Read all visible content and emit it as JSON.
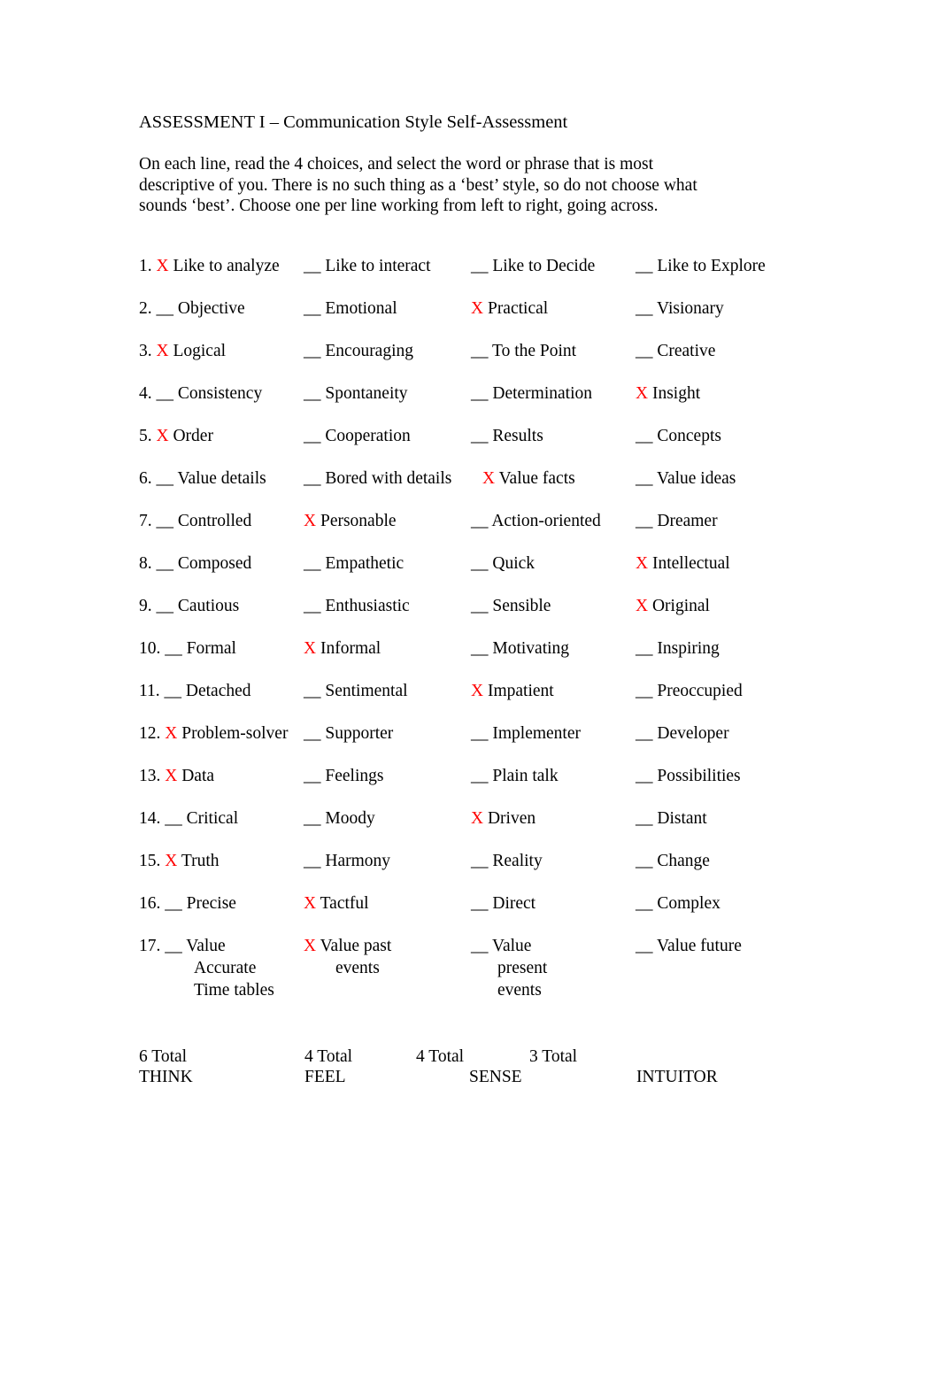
{
  "document": {
    "title": "ASSESSMENT I – Communication Style Self-Assessment",
    "intro_lines": [
      "On each line, read the 4 choices, and select the word or phrase that is most",
      "descriptive of you. There is no such thing as a ‘best’ style, so do not choose what",
      "sounds ‘best’. Choose one per line working from left to right, going across."
    ]
  },
  "marks": {
    "selected": "X",
    "unselected": "__",
    "selected_color": "#ff0000"
  },
  "rows": [
    {
      "number": "1.",
      "options": [
        {
          "mark": "X",
          "selected": true,
          "label": "Like to analyze"
        },
        {
          "mark": "__",
          "selected": false,
          "label": "Like to interact"
        },
        {
          "mark": "__",
          "selected": false,
          "label": "Like to Decide"
        },
        {
          "mark": "__",
          "selected": false,
          "label": "Like to Explore"
        }
      ]
    },
    {
      "number": "2.",
      "options": [
        {
          "mark": "__",
          "selected": false,
          "label": "Objective"
        },
        {
          "mark": "__",
          "selected": false,
          "label": "Emotional"
        },
        {
          "mark": "X",
          "selected": true,
          "label": "Practical"
        },
        {
          "mark": "__",
          "selected": false,
          "label": "Visionary"
        }
      ]
    },
    {
      "number": "3.",
      "options": [
        {
          "mark": "X",
          "selected": true,
          "label": "Logical"
        },
        {
          "mark": "__",
          "selected": false,
          "label": "Encouraging"
        },
        {
          "mark": "__",
          "selected": false,
          "label": "To the Point"
        },
        {
          "mark": "__",
          "selected": false,
          "label": "Creative"
        }
      ]
    },
    {
      "number": "4.",
      "options": [
        {
          "mark": "__",
          "selected": false,
          "label": "Consistency"
        },
        {
          "mark": "__",
          "selected": false,
          "label": "Spontaneity"
        },
        {
          "mark": "__",
          "selected": false,
          "label": "Determination"
        },
        {
          "mark": "X",
          "selected": true,
          "label": "Insight"
        }
      ]
    },
    {
      "number": "5.",
      "options": [
        {
          "mark": "X",
          "selected": true,
          "label": "Order"
        },
        {
          "mark": "__",
          "selected": false,
          "label": "Cooperation"
        },
        {
          "mark": "__",
          "selected": false,
          "label": "Results"
        },
        {
          "mark": "__",
          "selected": false,
          "label": "Concepts"
        }
      ]
    },
    {
      "number": "6.",
      "options": [
        {
          "mark": "__",
          "selected": false,
          "label": "Value details"
        },
        {
          "mark": "__",
          "selected": false,
          "label": "Bored with details"
        },
        {
          "mark": "X",
          "selected": true,
          "label": "Value facts"
        },
        {
          "mark": "__",
          "selected": false,
          "label": "Value ideas"
        }
      ]
    },
    {
      "number": "7.",
      "options": [
        {
          "mark": "__",
          "selected": false,
          "label": "Controlled"
        },
        {
          "mark": "X",
          "selected": true,
          "label": "Personable"
        },
        {
          "mark": "__",
          "selected": false,
          "label": "Action-oriented"
        },
        {
          "mark": "__",
          "selected": false,
          "label": "Dreamer"
        }
      ]
    },
    {
      "number": "8.",
      "options": [
        {
          "mark": "__",
          "selected": false,
          "label": "Composed"
        },
        {
          "mark": "__",
          "selected": false,
          "label": "Empathetic"
        },
        {
          "mark": "__",
          "selected": false,
          "label": "Quick"
        },
        {
          "mark": "X",
          "selected": true,
          "label": "Intellectual"
        }
      ]
    },
    {
      "number": "9.",
      "options": [
        {
          "mark": "__",
          "selected": false,
          "label": "Cautious"
        },
        {
          "mark": "__",
          "selected": false,
          "label": "Enthusiastic"
        },
        {
          "mark": "__",
          "selected": false,
          "label": "Sensible"
        },
        {
          "mark": "X",
          "selected": true,
          "label": "Original"
        }
      ]
    },
    {
      "number": "10.",
      "options": [
        {
          "mark": "__",
          "selected": false,
          "label": "Formal"
        },
        {
          "mark": "X",
          "selected": true,
          "label": "Informal"
        },
        {
          "mark": "__",
          "selected": false,
          "label": "Motivating"
        },
        {
          "mark": "__",
          "selected": false,
          "label": "Inspiring"
        }
      ]
    },
    {
      "number": "11.",
      "options": [
        {
          "mark": "__",
          "selected": false,
          "label": "Detached"
        },
        {
          "mark": "__",
          "selected": false,
          "label": "Sentimental"
        },
        {
          "mark": "X",
          "selected": true,
          "label": "Impatient"
        },
        {
          "mark": "__",
          "selected": false,
          "label": "Preoccupied"
        }
      ]
    },
    {
      "number": "12.",
      "options": [
        {
          "mark": "X",
          "selected": true,
          "label": "Problem-solver"
        },
        {
          "mark": "__",
          "selected": false,
          "label": "Supporter"
        },
        {
          "mark": "__",
          "selected": false,
          "label": "Implementer"
        },
        {
          "mark": "__",
          "selected": false,
          "label": "Developer"
        }
      ]
    },
    {
      "number": "13.",
      "options": [
        {
          "mark": "X",
          "selected": true,
          "label": "Data"
        },
        {
          "mark": "__",
          "selected": false,
          "label": "Feelings"
        },
        {
          "mark": "__",
          "selected": false,
          "label": "Plain talk"
        },
        {
          "mark": "__",
          "selected": false,
          "label": "Possibilities"
        }
      ]
    },
    {
      "number": "14.",
      "options": [
        {
          "mark": "__",
          "selected": false,
          "label": "Critical"
        },
        {
          "mark": "__",
          "selected": false,
          "label": "Moody"
        },
        {
          "mark": "X",
          "selected": true,
          "label": "Driven"
        },
        {
          "mark": "__",
          "selected": false,
          "label": "Distant"
        }
      ]
    },
    {
      "number": "15.",
      "options": [
        {
          "mark": "X",
          "selected": true,
          "label": "Truth"
        },
        {
          "mark": "__",
          "selected": false,
          "label": "Harmony"
        },
        {
          "mark": "__",
          "selected": false,
          "label": "Reality"
        },
        {
          "mark": "__",
          "selected": false,
          "label": "Change"
        }
      ]
    },
    {
      "number": "16.",
      "options": [
        {
          "mark": "__",
          "selected": false,
          "label": "Precise"
        },
        {
          "mark": "X",
          "selected": true,
          "label": "Tactful"
        },
        {
          "mark": "__",
          "selected": false,
          "label": "Direct"
        },
        {
          "mark": "__",
          "selected": false,
          "label": "Complex"
        }
      ]
    },
    {
      "number": "17.",
      "options": [
        {
          "mark": "__",
          "selected": false,
          "label": "Value",
          "extra_lines": [
            "Accurate",
            "Time tables"
          ]
        },
        {
          "mark": "X",
          "selected": true,
          "label": "Value past",
          "extra_lines": [
            "events"
          ]
        },
        {
          "mark": "__",
          "selected": false,
          "label": "Value",
          "extra_lines": [
            "present",
            "events"
          ]
        },
        {
          "mark": "__",
          "selected": false,
          "label": "Value future"
        }
      ]
    }
  ],
  "totals": [
    {
      "count": "6",
      "word": "Total",
      "category": "THINK"
    },
    {
      "count": "4",
      "word": "Total",
      "category": "FEEL"
    },
    {
      "count": "4",
      "word": "Total",
      "category": "SENSE"
    },
    {
      "count": "3",
      "word": "Total",
      "category": "INTUITOR"
    }
  ]
}
